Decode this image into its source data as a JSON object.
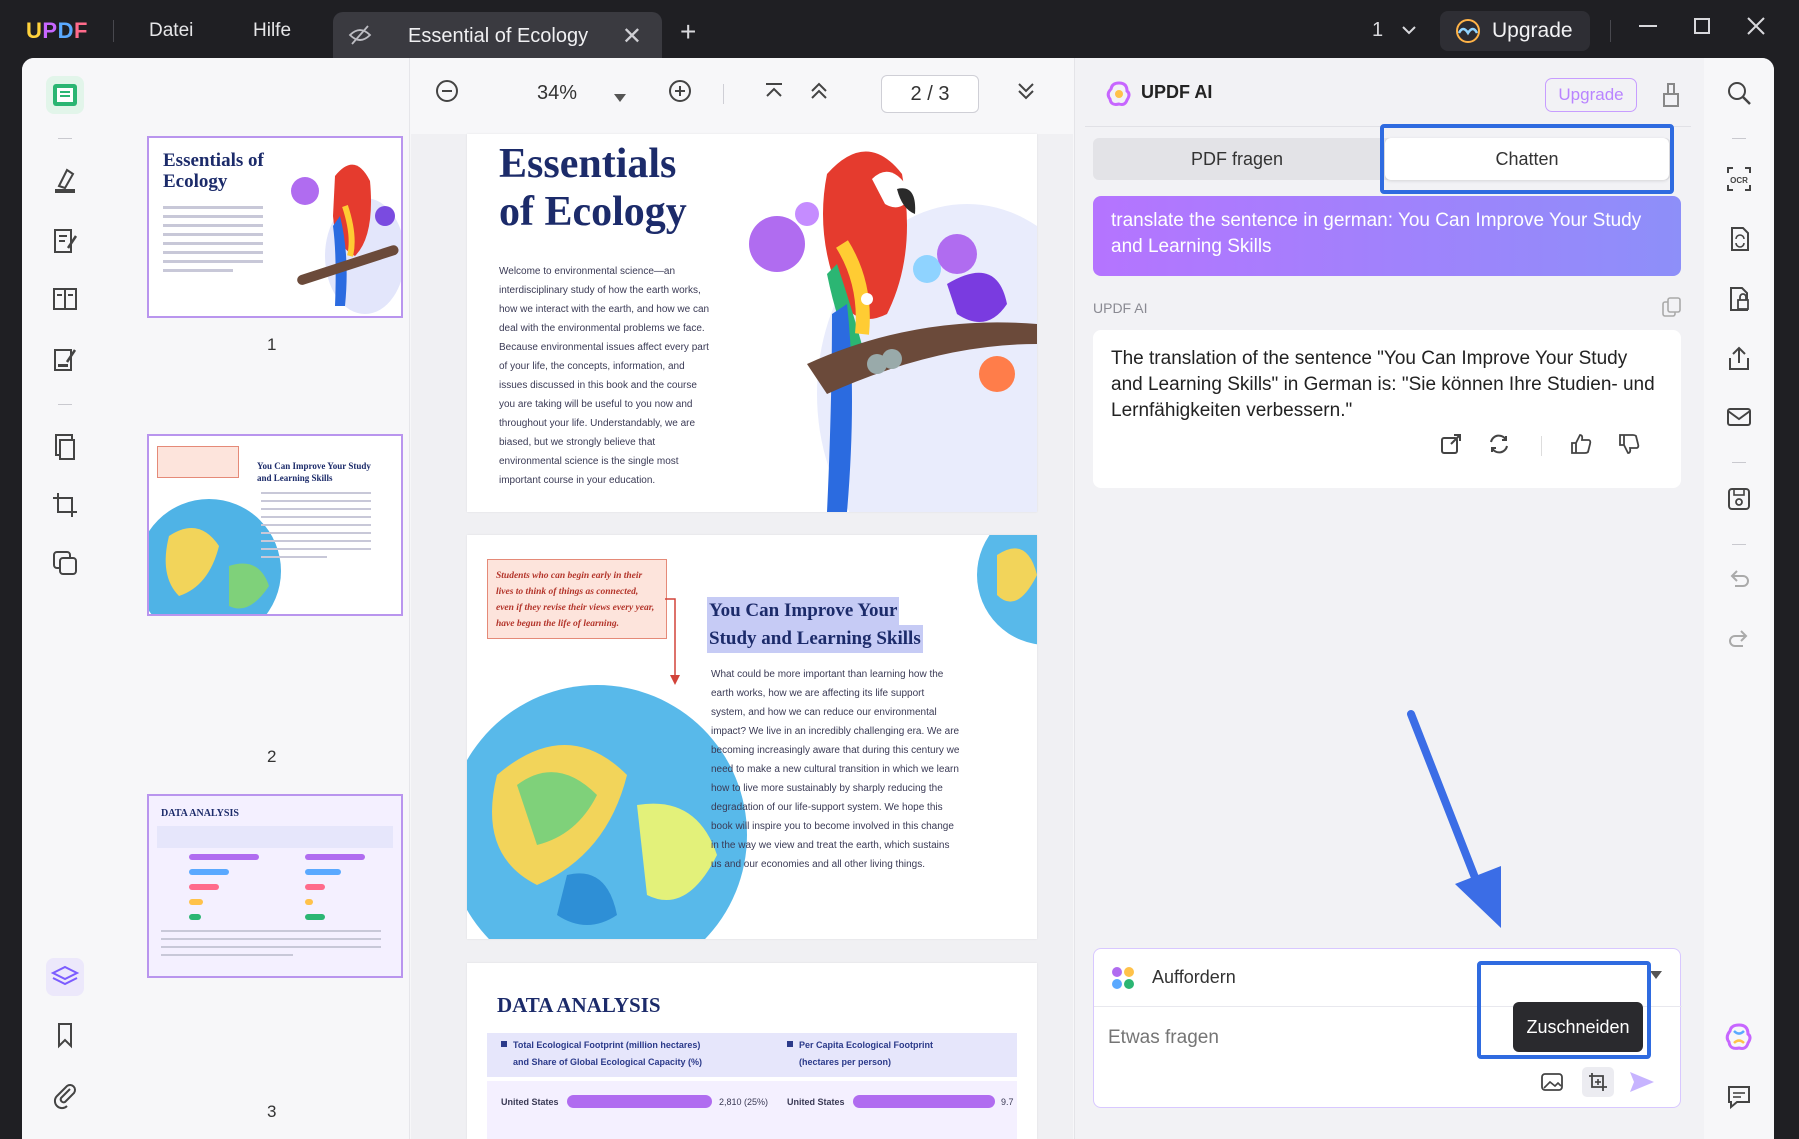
{
  "app": {
    "logo": "UPDF",
    "menu": [
      "Datei",
      "Hilfe"
    ],
    "tab_title": "Essential of Ecology",
    "tab_close": "✕",
    "new_tab": "+",
    "page_counter": "1",
    "upgrade_label": "Upgrade"
  },
  "thumbnails": {
    "pages": [
      {
        "number": "1",
        "title": "Essentials of Ecology"
      },
      {
        "number": "2",
        "title": "You Can Improve Your Study and Learning Skills"
      },
      {
        "number": "3",
        "title": "DATA ANALYSIS"
      }
    ]
  },
  "viewer": {
    "zoom": "34%",
    "page_indicator": "2 / 3",
    "page1": {
      "title_line1": "Essentials",
      "title_line2": "of Ecology",
      "body": "Welcome to environmental science—an interdisciplinary study of how the earth works, how we interact with the earth, and how we can deal with the environmental problems we face. Because environmental issues affect every part of your life, the concepts, information, and issues discussed in this book and the course you are taking will be useful to you now and throughout your life. Understandably, we are biased, but we strongly believe that environmental science is the single most important course in your education."
    },
    "page2": {
      "callout": "Students who can begin early in their lives to think of things as connected, even if they revise their views every year, have begun the life of learning.",
      "heading_line1": "You Can Improve Your",
      "heading_line2": "Study and Learning Skills",
      "body": "What could be more important than learning how the earth works, how we are affecting its life support system, and how we can reduce our environmental impact? We live in an incredibly challenging era. We are becoming increasingly aware that during this century we need to make a new cultural transition in which we learn how to live more sustainably by sharply reducing the degradation of our life-support system. We hope this book will inspire you to become involved in this change in the way we view and treat the earth, which sustains us and our economies and all other living things."
    },
    "page3": {
      "title": "DATA ANALYSIS",
      "legend_left_1": "Total Ecological Footprint (million hectares)",
      "legend_left_2": "and Share of Global Ecological Capacity (%)",
      "legend_right_1": "Per Capita Ecological Footprint",
      "legend_right_2": "(hectares per person)",
      "row_label": "United States",
      "row_value_left": "2,810 (25%)",
      "row_value_right": "9.7"
    }
  },
  "ai": {
    "title": "UPDF AI",
    "upgrade": "Upgrade",
    "tab_pdf": "PDF fragen",
    "tab_chat": "Chatten",
    "user_message": "translate the sentence in german: You Can Improve Your Study and Learning Skills",
    "assistant_label": "UPDF AI",
    "answer": "The translation of the sentence \"You Can Improve Your Study and Learning Skills\" in German is: \"Sie können Ihre Studien- und Lernfähigkeiten verbessern.\"",
    "prompt_label": "Auffordern",
    "input_placeholder": "Etwas fragen",
    "tooltip": "Zuschneiden"
  },
  "colors": {
    "accent_purple": "#b574ff",
    "highlight_blue": "#2f6be0",
    "active_green": "#e2f5ea"
  }
}
